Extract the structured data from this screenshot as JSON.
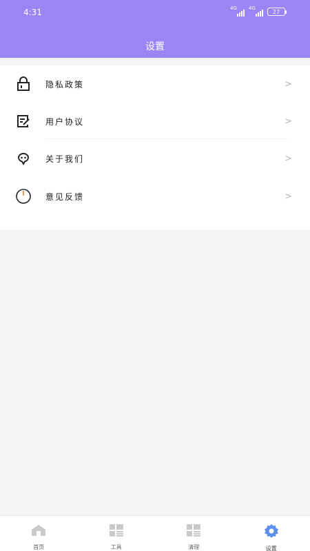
{
  "status_bar": {
    "time": "4:31",
    "network_1": "4G",
    "network_2": "4G",
    "battery": "27"
  },
  "header": {
    "title": "设置",
    "background": "#9b85f4"
  },
  "menu": {
    "items": [
      {
        "label": "隐私政策",
        "icon": "lock-icon",
        "chevron": ">"
      },
      {
        "label": "用户协议",
        "icon": "document-edit-icon",
        "chevron": ">"
      },
      {
        "label": "关于我们",
        "icon": "chat-bubble-icon",
        "chevron": ">"
      },
      {
        "label": "意见反馈",
        "icon": "power-icon",
        "chevron": ">"
      }
    ]
  },
  "tabbar": {
    "tabs": [
      {
        "label": "首页",
        "icon": "home-icon"
      },
      {
        "label": "工具",
        "icon": "tools-grid-icon"
      },
      {
        "label": "清理",
        "icon": "clean-grid-icon"
      },
      {
        "label": "设置",
        "icon": "settings-gear-icon",
        "active": true
      }
    ],
    "active_color": "#5b8ff0",
    "inactive_color": "#c9c9c9"
  }
}
